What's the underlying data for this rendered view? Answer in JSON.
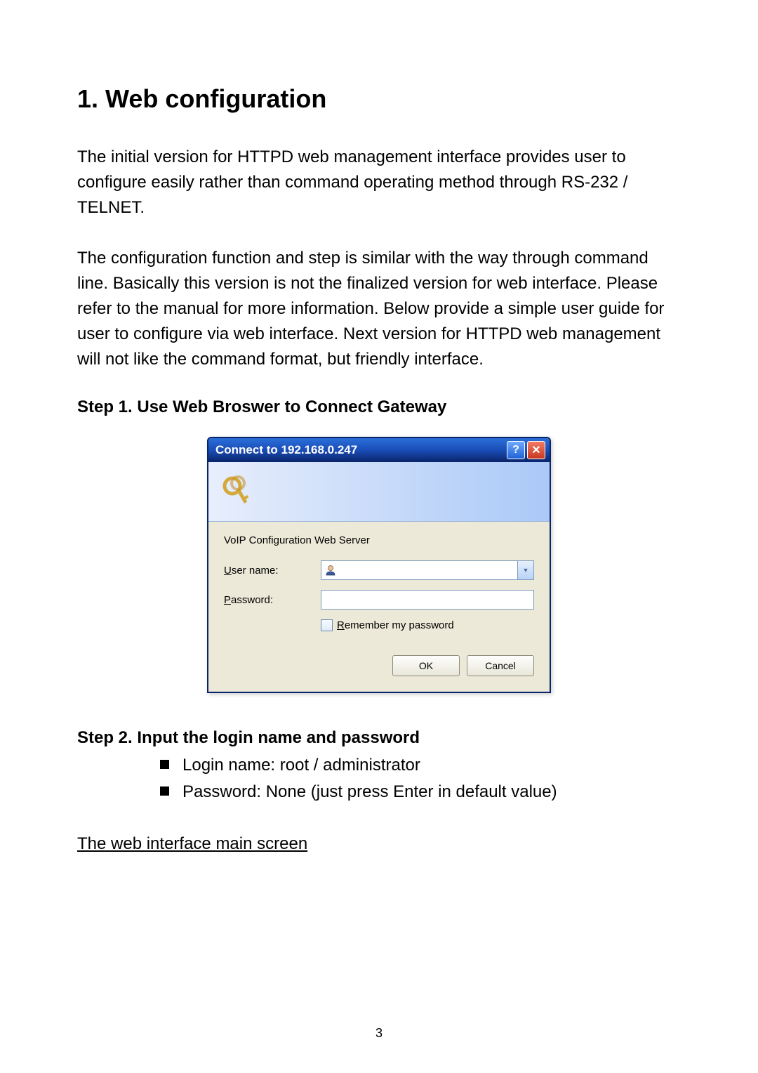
{
  "heading": "1.   Web configuration",
  "paragraph1": "The initial version for HTTPD web management interface provides user to configure easily rather than command operating method through RS-232 / TELNET.",
  "paragraph2": "The configuration function and step is similar with the way through command line. Basically this version is not the finalized version for web interface. Please refer to the manual for more information. Below provide a simple user guide for user to configure via web interface. Next version for HTTPD web management will not like the command format, but friendly interface.",
  "step1": "Step 1.   Use Web Broswer to Connect Gateway",
  "dialog": {
    "title": "Connect to 192.168.0.247",
    "realm": "VoIP Configuration Web Server",
    "user_label_pre": "U",
    "user_label_rest": "ser name:",
    "pw_label_pre": "P",
    "pw_label_rest": "assword:",
    "remember_pre": "R",
    "remember_rest": "emember my password",
    "ok": "OK",
    "cancel": "Cancel"
  },
  "step2": "Step 2.   Input the login name and password",
  "bullets": {
    "b1": "Login name: root / administrator",
    "b2": "Password: None (just press Enter in default value)"
  },
  "section_link": "The web interface main screen",
  "page_number": "3"
}
